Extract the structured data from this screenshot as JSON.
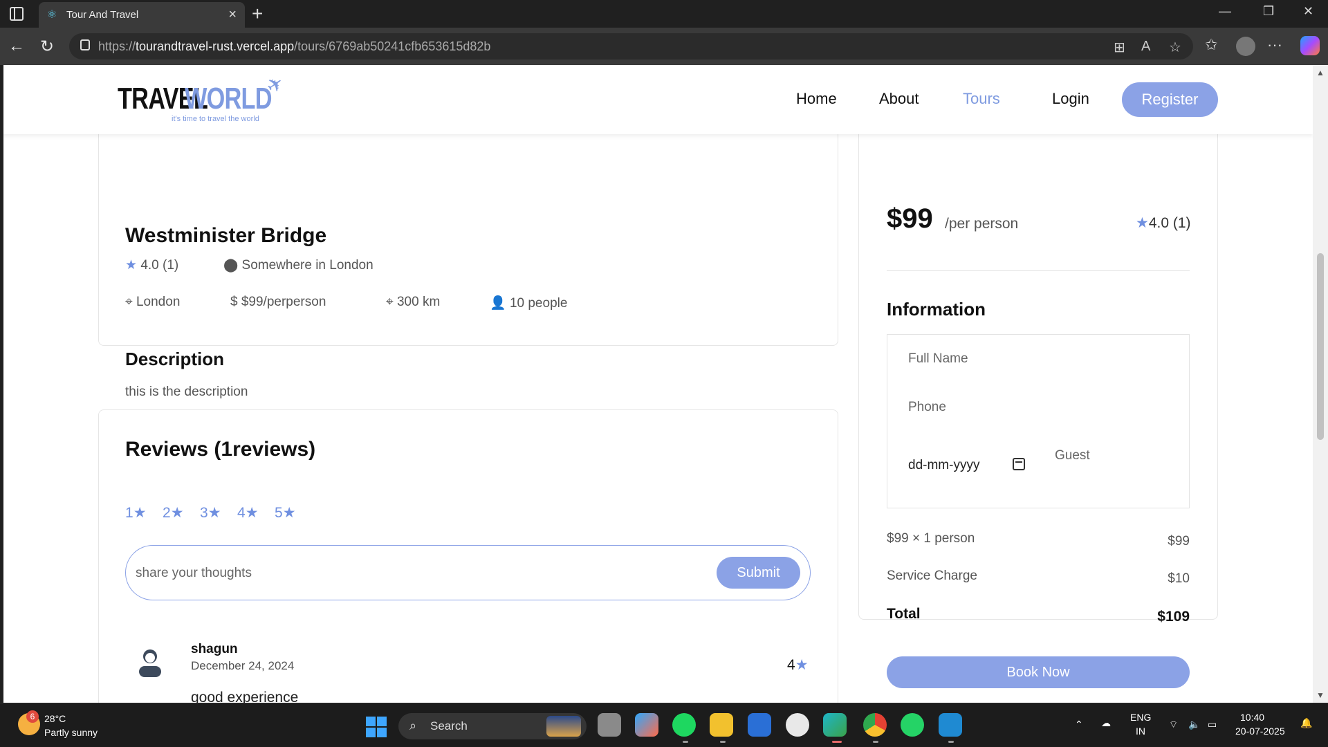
{
  "browser": {
    "tab_title": "Tour And Travel",
    "url_prefix": "https://",
    "url_domain": "tourandtravel-rust.vercel.app",
    "url_path": "/tours/6769ab50241cfb653615d82b"
  },
  "header": {
    "logo_text_1": "TRAVEL",
    "logo_text_2": "WORLD",
    "logo_tagline": "it's time to travel the world",
    "nav": [
      "Home",
      "About",
      "Tours",
      "Login"
    ],
    "register_label": "Register"
  },
  "tour": {
    "title": "Westminister Bridge",
    "rating": "4.0 (1)",
    "address": "Somewhere in London",
    "city": "London",
    "price_per": "$99/perperson",
    "distance": "300 km",
    "group_size": "10 people",
    "description_heading": "Description",
    "description": "this is the description"
  },
  "reviews": {
    "heading": "Reviews (1reviews)",
    "rating_options": [
      "1",
      "2",
      "3",
      "4",
      "5"
    ],
    "input_placeholder": "share your thoughts",
    "submit_label": "Submit",
    "items": [
      {
        "user": "shagun",
        "date": "December 24, 2024",
        "rating": "4",
        "text": "good experience"
      }
    ]
  },
  "booking": {
    "price": "$99",
    "per_label": "/per person",
    "rating": "4.0 (1)",
    "info_heading": "Information",
    "fullname_placeholder": "Full Name",
    "phone_placeholder": "Phone",
    "date_placeholder": "dd-mm-yyyy",
    "guest_placeholder": "Guest",
    "line_label": "$99",
    "line_times": "×",
    "line_persons": "1 person",
    "line_value": "$99",
    "service_label": "Service Charge",
    "service_value": "$10",
    "total_label": "Total",
    "total_value": "$109",
    "book_label": "Book Now"
  },
  "taskbar": {
    "weather_badge": "6",
    "temperature": "28°C",
    "weather": "Partly sunny",
    "search_label": "Search",
    "lang_1": "ENG",
    "lang_2": "IN",
    "time": "10:40",
    "date": "20-07-2025"
  },
  "colors": {
    "accent": "#8ba2e6",
    "star": "#6f8fe0"
  }
}
